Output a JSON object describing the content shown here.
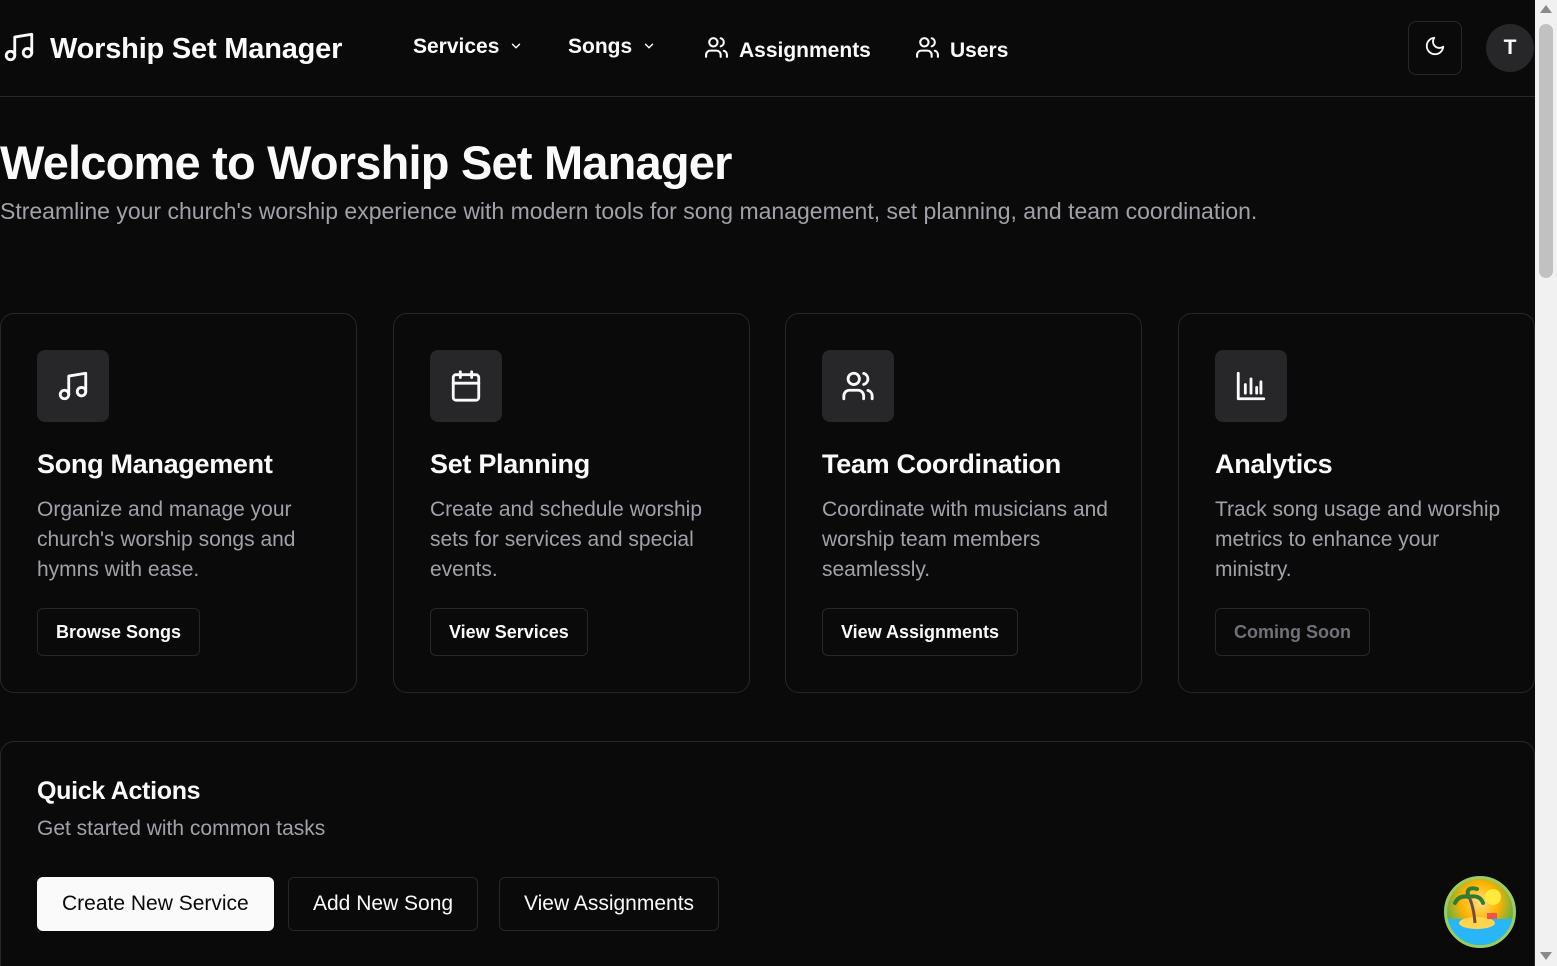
{
  "header": {
    "app_title": "Worship Set Manager",
    "nav": [
      {
        "label": "Services",
        "icon": "chevron-down-icon"
      },
      {
        "label": "Songs",
        "icon": "chevron-down-icon"
      },
      {
        "label": "Assignments",
        "icon": "users-icon"
      },
      {
        "label": "Users",
        "icon": "users-icon"
      }
    ],
    "theme_toggle_icon": "moon-icon",
    "avatar_initial": "T"
  },
  "hero": {
    "title": "Welcome to Worship Set Manager",
    "subtitle": "Streamline your church's worship experience with modern tools for song management, set planning, and team coordination."
  },
  "features": [
    {
      "icon": "music-note-icon",
      "title": "Song Management",
      "description": "Organize and manage your church's worship songs and hymns with ease.",
      "button": "Browse Songs",
      "disabled": false
    },
    {
      "icon": "calendar-icon",
      "title": "Set Planning",
      "description": "Create and schedule worship sets for services and special events.",
      "button": "View Services",
      "disabled": false
    },
    {
      "icon": "users-icon",
      "title": "Team Coordination",
      "description": "Coordinate with musicians and worship team members seamlessly.",
      "button": "View Assignments",
      "disabled": false
    },
    {
      "icon": "bar-chart-icon",
      "title": "Analytics",
      "description": "Track song usage and worship metrics to enhance your ministry.",
      "button": "Coming Soon",
      "disabled": true
    }
  ],
  "quick_actions": {
    "title": "Quick Actions",
    "subtitle": "Get started with common tasks",
    "buttons": [
      "Create New Service",
      "Add New Song",
      "View Assignments"
    ]
  },
  "colors": {
    "background": "#0a0a0a",
    "border": "#27272a",
    "text": "#fafafa",
    "muted_text": "#a1a1aa",
    "primary_button_bg": "#fafafa"
  }
}
